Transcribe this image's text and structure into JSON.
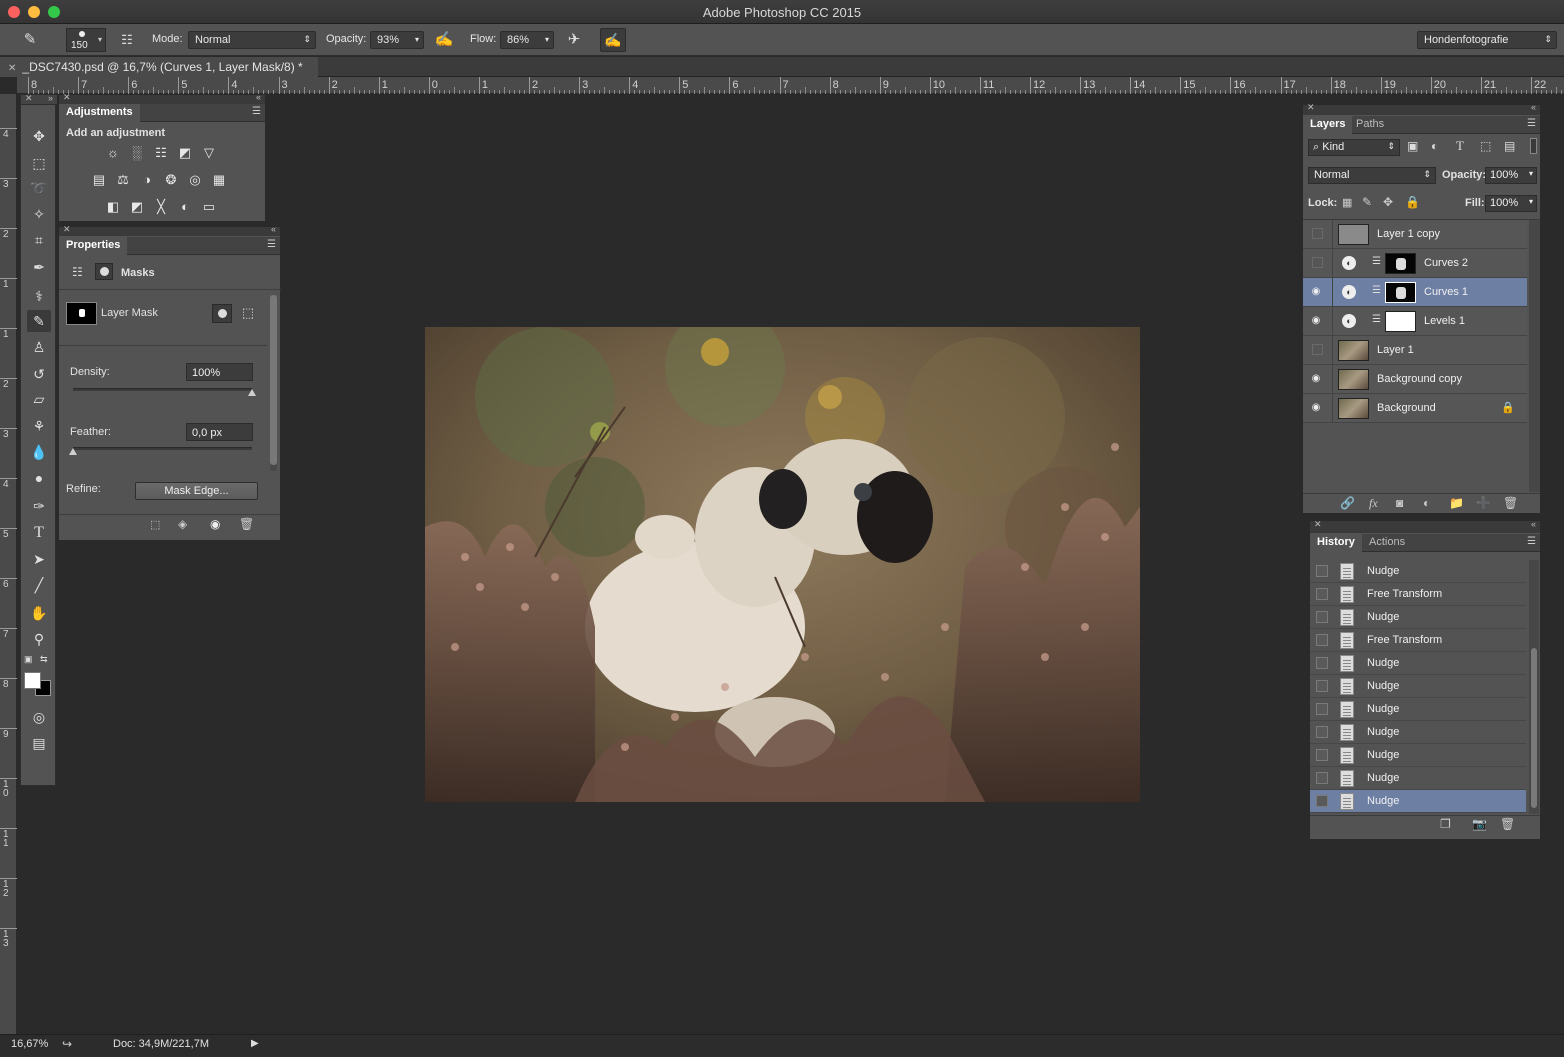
{
  "app": {
    "title": "Adobe Photoshop CC 2015"
  },
  "options_bar": {
    "brush_size": "150",
    "mode_label": "Mode:",
    "mode_value": "Normal",
    "opacity_label": "Opacity:",
    "opacity_value": "93%",
    "flow_label": "Flow:",
    "flow_value": "86%",
    "workspace": "Hondenfotografie"
  },
  "document": {
    "tab_title": "_DSC7430.psd @ 16,7% (Curves 1, Layer Mask/8) *"
  },
  "ruler_h": [
    "8",
    "7",
    "6",
    "5",
    "4",
    "3",
    "2",
    "1",
    "0",
    "1",
    "2",
    "3",
    "4",
    "5",
    "6",
    "7",
    "8",
    "9",
    "10",
    "11",
    "12",
    "13",
    "14",
    "15",
    "16",
    "17",
    "18",
    "19",
    "20",
    "21",
    "22"
  ],
  "ruler_v": [
    "4",
    "3",
    "2",
    "1",
    "1",
    "2",
    "3",
    "4",
    "5",
    "6",
    "7",
    "8",
    "9",
    "1 0",
    "1 1",
    "1 2",
    "1 3"
  ],
  "adjustments": {
    "tab": "Adjustments",
    "heading": "Add an adjustment",
    "icons": [
      "brightness-contrast-icon",
      "levels-icon",
      "curves-icon",
      "exposure-icon",
      "vibrance-icon",
      "hue-saturation-icon",
      "color-balance-icon",
      "black-white-icon",
      "photo-filter-icon",
      "channel-mixer-icon",
      "color-lookup-icon",
      "invert-icon",
      "posterize-icon",
      "threshold-icon",
      "selective-color-icon",
      "gradient-map-icon"
    ]
  },
  "properties": {
    "tab": "Properties",
    "section": "Masks",
    "mask_label": "Layer Mask",
    "density_label": "Density:",
    "density_value": "100%",
    "feather_label": "Feather:",
    "feather_value": "0,0 px",
    "refine_label": "Refine:",
    "mask_edge_button": "Mask Edge...",
    "density_level": 1.0,
    "feather_level": 0.0
  },
  "layers_panel": {
    "tab_layers": "Layers",
    "tab_paths": "Paths",
    "filter_kind": "Kind",
    "blend_mode": "Normal",
    "opacity_label": "Opacity:",
    "opacity_value": "100%",
    "lock_label": "Lock:",
    "fill_label": "Fill:",
    "fill_value": "100%",
    "layers": [
      {
        "name": "Layer 1 copy",
        "visible": false,
        "type": "gray",
        "selected": false
      },
      {
        "name": "Curves 2",
        "visible": false,
        "type": "adjust",
        "selected": false
      },
      {
        "name": "Curves 1",
        "visible": true,
        "type": "adjust",
        "selected": true
      },
      {
        "name": "Levels 1",
        "visible": true,
        "type": "adjust-white",
        "selected": false
      },
      {
        "name": "Layer 1",
        "visible": false,
        "type": "photo",
        "selected": false
      },
      {
        "name": "Background copy",
        "visible": true,
        "type": "photo",
        "selected": false
      },
      {
        "name": "Background",
        "visible": true,
        "type": "photo-locked",
        "selected": false
      }
    ]
  },
  "history_panel": {
    "tab_history": "History",
    "tab_actions": "Actions",
    "items": [
      "Nudge",
      "Free Transform",
      "Nudge",
      "Free Transform",
      "Nudge",
      "Nudge",
      "Nudge",
      "Nudge",
      "Nudge",
      "Nudge",
      "Nudge"
    ],
    "selected_index": 10
  },
  "status_bar": {
    "zoom": "16,67%",
    "doc_info": "Doc: 34,9M/221,7M"
  },
  "colors": {
    "accent_selection": "#6d7fa3",
    "panel_bg": "#535353",
    "canvas_bg": "#2a2a2a"
  }
}
